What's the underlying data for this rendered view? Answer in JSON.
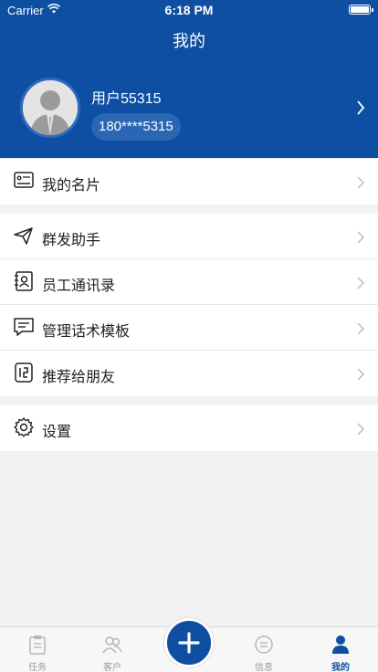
{
  "status_bar": {
    "carrier": "Carrier",
    "time": "6:18 PM"
  },
  "nav": {
    "title": "我的"
  },
  "profile": {
    "username": "用户55315",
    "phone": "180****5315"
  },
  "menu": {
    "card": {
      "label": "我的名片",
      "icon": "id-card-icon"
    },
    "items": [
      {
        "label": "群发助手",
        "icon": "send-icon"
      },
      {
        "label": "员工通讯录",
        "icon": "contacts-icon"
      },
      {
        "label": "管理话术模板",
        "icon": "chat-template-icon"
      },
      {
        "label": "推荐给朋友",
        "icon": "share-icon"
      }
    ],
    "settings": {
      "label": "设置",
      "icon": "gear-icon"
    }
  },
  "tabbar": {
    "tabs": [
      {
        "label": "任务",
        "icon": "clipboard-icon",
        "active": false
      },
      {
        "label": "客户",
        "icon": "customers-icon",
        "active": false
      },
      {
        "label": "信息",
        "icon": "message-icon",
        "active": false
      },
      {
        "label": "我的",
        "icon": "person-icon",
        "active": true
      }
    ],
    "fab_icon": "plus-icon"
  },
  "colors": {
    "primary": "#0e4fa3",
    "background": "#f2f2f2",
    "inactive_tab": "#9a9a9a"
  }
}
